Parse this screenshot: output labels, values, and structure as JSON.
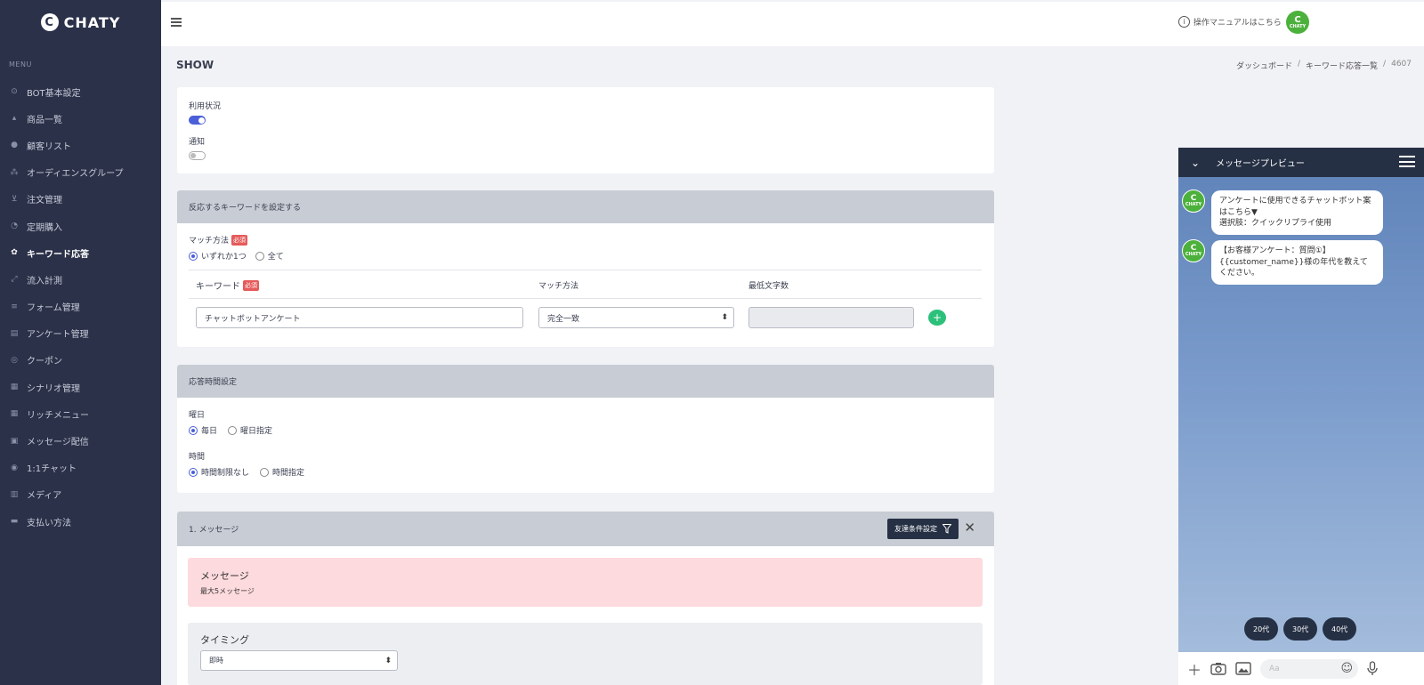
{
  "brand": {
    "name": "CHATY",
    "mark": "C"
  },
  "sidebar": {
    "menu_label": "MENU",
    "items": [
      {
        "label": "BOT基本設定",
        "icon": "robot-icon"
      },
      {
        "label": "商品一覧",
        "icon": "shirt-icon"
      },
      {
        "label": "顧客リスト",
        "icon": "person-icon"
      },
      {
        "label": "オーディエンスグループ",
        "icon": "group-icon"
      },
      {
        "label": "注文管理",
        "icon": "cart-icon"
      },
      {
        "label": "定期購入",
        "icon": "clock-icon"
      },
      {
        "label": "キーワード応答",
        "icon": "gear-icon",
        "active": true
      },
      {
        "label": "流入計測",
        "icon": "measure-icon"
      },
      {
        "label": "フォーム管理",
        "icon": "form-icon"
      },
      {
        "label": "アンケート管理",
        "icon": "survey-icon"
      },
      {
        "label": "クーポン",
        "icon": "coupon-icon"
      },
      {
        "label": "シナリオ管理",
        "icon": "scenario-icon"
      },
      {
        "label": "リッチメニュー",
        "icon": "grid-icon"
      },
      {
        "label": "メッセージ配信",
        "icon": "message-icon"
      },
      {
        "label": "1:1チャット",
        "icon": "chat-icon"
      },
      {
        "label": "メディア",
        "icon": "media-icon"
      },
      {
        "label": "支払い方法",
        "icon": "payment-icon"
      }
    ]
  },
  "header": {
    "manual_link": "操作マニュアルはこちら",
    "info_glyph": "i",
    "avatar_text": "CHATY"
  },
  "page": {
    "title": "SHOW",
    "breadcrumb": [
      "ダッシュボード",
      "キーワード応答一覧",
      "4607"
    ]
  },
  "status_card": {
    "usage_label": "利用状況",
    "usage_on": true,
    "notify_label": "通知",
    "notify_on": false
  },
  "keyword_card": {
    "title": "反応するキーワードを設定する",
    "match_label": "マッチ方法",
    "required_badge": "必須",
    "match_options": [
      "いずれか1つ",
      "全て"
    ],
    "selected_match": 0,
    "columns": [
      "キーワード",
      "マッチ方法",
      "最低文字数"
    ],
    "row": {
      "keyword": "チャットボットアンケート",
      "match": "完全一致",
      "min_chars": ""
    },
    "add_glyph": "+"
  },
  "time_card": {
    "title": "応答時間設定",
    "day_label": "曜日",
    "day_options": [
      "毎日",
      "曜日指定"
    ],
    "time_label": "時間",
    "time_options": [
      "時間制限なし",
      "時間指定"
    ]
  },
  "message_card": {
    "title": "1. メッセージ",
    "filter_button": "友達条件設定",
    "close_glyph": "✕",
    "notice_title": "メッセージ",
    "notice_text": "最大5メッセージ",
    "timing_label": "タイミング",
    "timing_value": "即時"
  },
  "preview": {
    "title": "メッセージプレビュー",
    "chevron": "⌄",
    "avatar_text": "CHATY",
    "messages": [
      "アンケートに使用できるチャットボット案はこちら▼\n選択肢：クイックリプライ使用",
      "【お客様アンケート：質問①】\n{{customer_name}}様の年代を教えてください。"
    ],
    "quick_replies": [
      "20代",
      "30代",
      "40代"
    ],
    "input_placeholder": "Aa",
    "input_icons": [
      "plus-icon",
      "camera-icon",
      "image-icon",
      "emoji-icon",
      "mic-icon"
    ]
  },
  "colors": {
    "sidebar_bg": "#2b3149",
    "accent_blue": "#4a5fd8",
    "add_green": "#2cc17a",
    "brand_green": "#4cb13c",
    "required_red": "#e55a5a"
  }
}
